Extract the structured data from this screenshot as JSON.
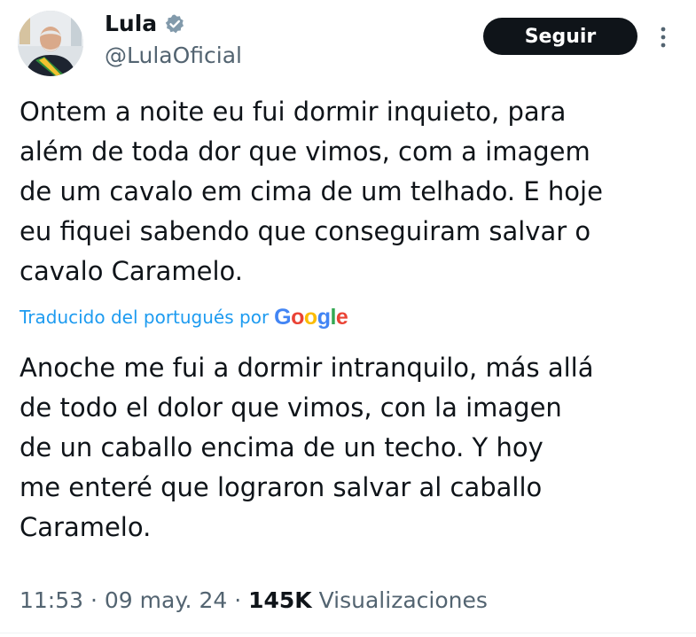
{
  "author": {
    "display_name": "Lula",
    "handle": "@LulaOficial",
    "verified_icon": "verified-badge-icon"
  },
  "actions": {
    "follow_label": "Seguir",
    "more_icon": "more-options-icon"
  },
  "tweet": {
    "text": "Ontem a noite eu fui dormir inquieto, para\nalém de toda dor que vimos, com a imagem\nde um cavalo em cima de um telhado. E hoje\neu fiquei sabendo que conseguiram salvar o\ncavalo Caramelo.",
    "translation_label": "Traducido del portugués por",
    "translation_provider": "Google",
    "translated_text": "Anoche me fui a dormir intranquilo, más allá\nde todo el dolor que vimos, con la imagen\nde un caballo encima de un techo. Y hoy\nme enteré que lograron salvar al caballo\nCaramelo."
  },
  "meta": {
    "time": "11:53",
    "separator": " · ",
    "date": "09 may. 24",
    "views_count": "145K",
    "views_label": " Visualizaciones"
  },
  "colors": {
    "text_primary": "#0f1419",
    "text_secondary": "#536471",
    "link_blue": "#1d9bf0",
    "button_bg": "#0f1419",
    "badge_gray": "#829aab"
  }
}
